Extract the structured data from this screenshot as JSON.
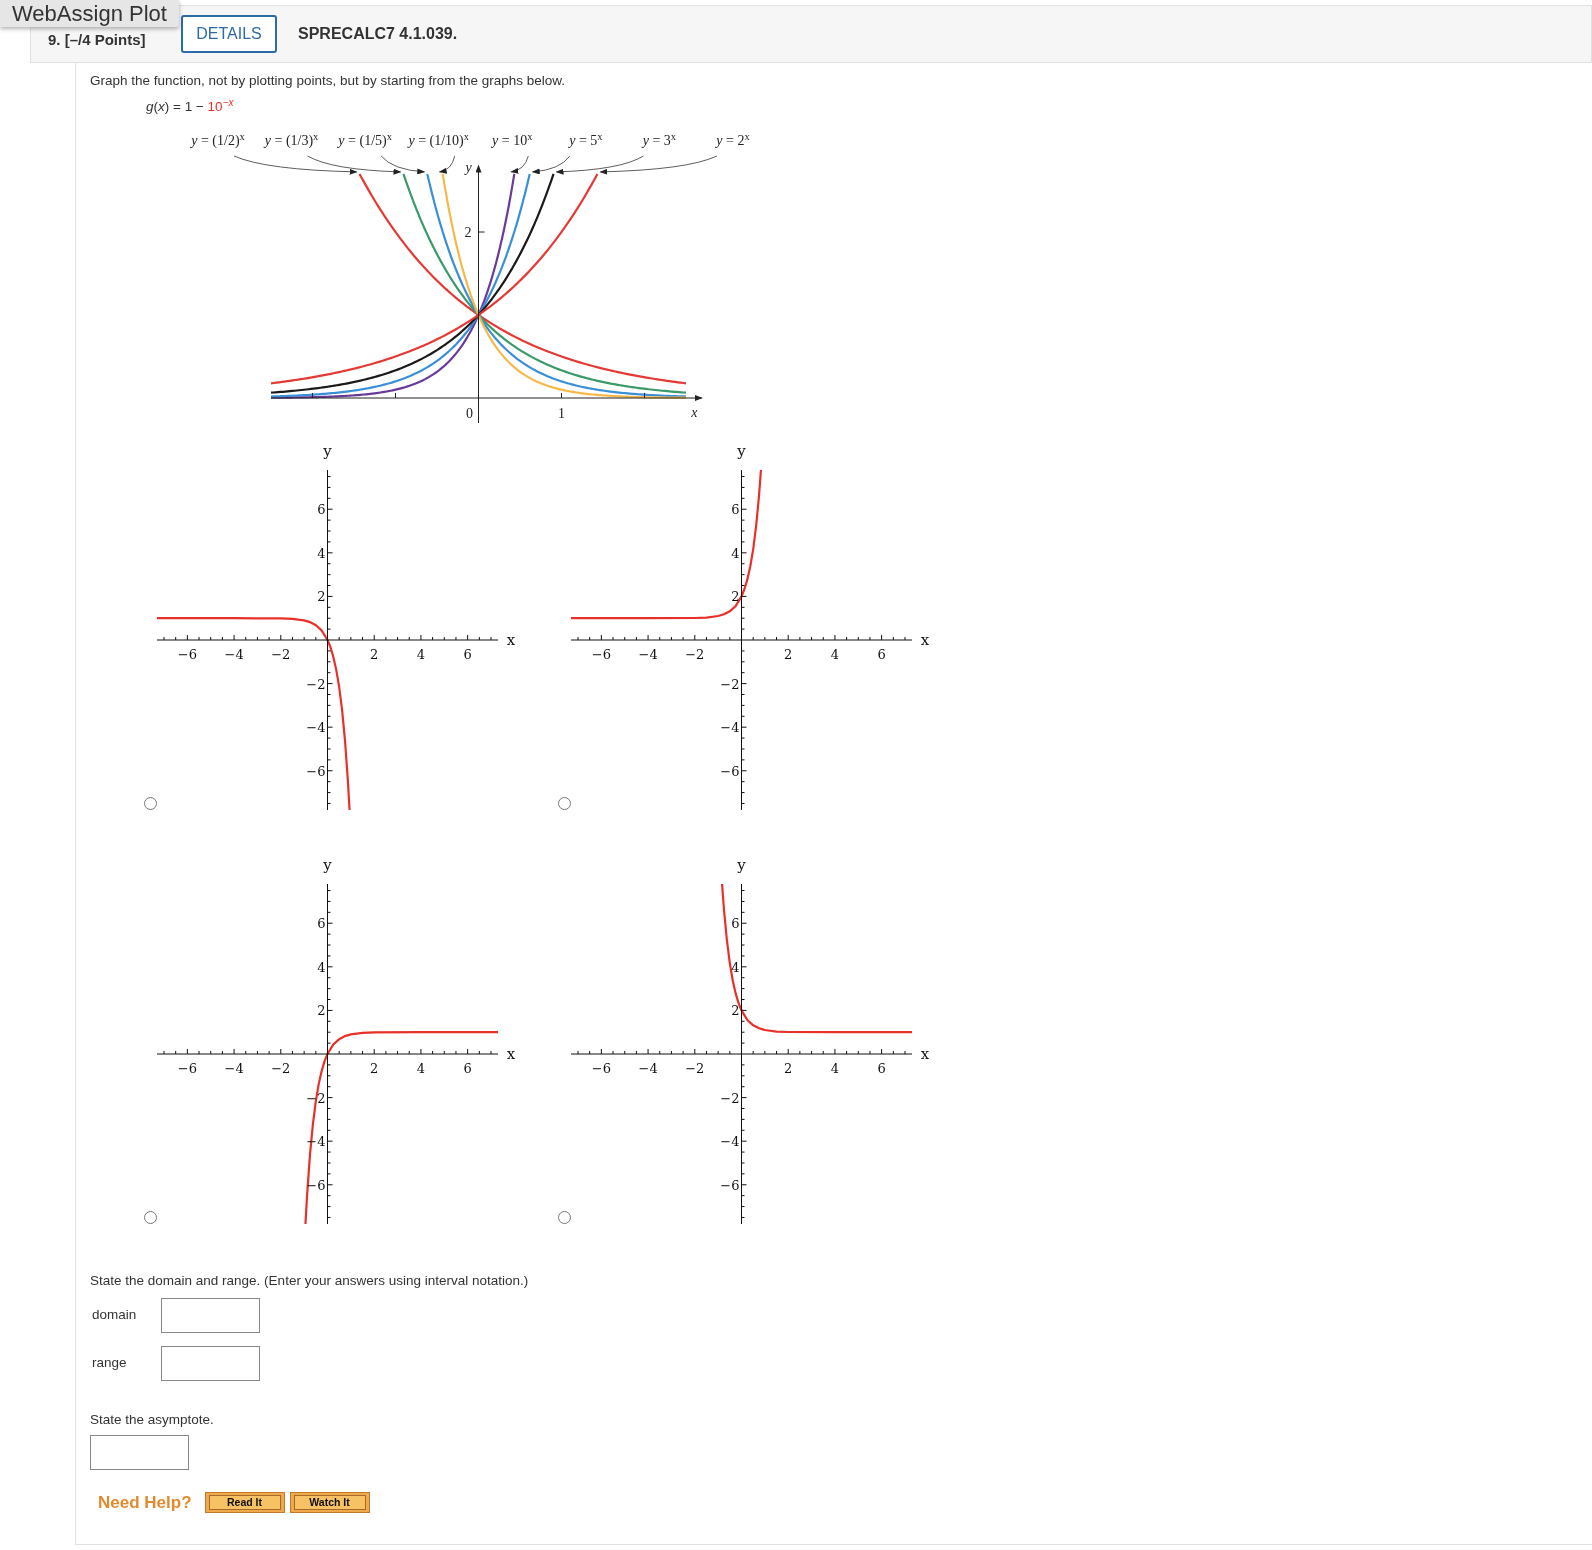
{
  "tooltip": {
    "text": "WebAssign Plot"
  },
  "header": {
    "number": "9. [–/4 Points]",
    "details_button": "DETAILS",
    "problem_id": "SPRECALC7 4.1.039."
  },
  "question": {
    "prompt": "Graph the function, not by plotting points, but by starting from the graphs below.",
    "formula": {
      "text": "*g*(*x*) = 1 − ",
      "highlight": "10$^{−x}$"
    }
  },
  "figure": {
    "x_axis_label": "x",
    "y_axis_label": "y",
    "x_tick_labels": [
      "0",
      "1"
    ],
    "y_tick_labels": [
      "2"
    ],
    "curve_labels": [
      "*y* = (1/2)$^{x}$",
      "*y* = (1/3)$^{x}$",
      "*y* = (1/5)$^{x}$",
      "*y* = (1/10)$^{x}$",
      "*y* = 10$^{x}$",
      "*y* = 5$^{x}$",
      "*y* = 3$^{x}$",
      "*y* = 2$^{x}$"
    ]
  },
  "choices": [
    {
      "selected": false,
      "chart_data": {
        "type": "line",
        "xlabel": "x",
        "ylabel": "y",
        "xlim": [
          -7.3,
          7.3
        ],
        "ylim": [
          -7.8,
          7.8
        ],
        "xticks": [
          {
            "value": -6,
            "label": "−6"
          },
          {
            "value": -4,
            "label": "−4"
          },
          {
            "value": -2,
            "label": "−2"
          },
          2,
          4,
          6
        ],
        "yticks": [
          {
            "value": -6,
            "label": "−6"
          },
          {
            "value": -4,
            "label": "−4"
          },
          {
            "value": -2,
            "label": "−2"
          },
          2,
          4,
          6
        ],
        "x": [
          -7.3,
          -4,
          -2,
          -1.5,
          -1,
          -0.75,
          -0.5,
          -0.25,
          0,
          0.125,
          0.25,
          0.375,
          0.5,
          0.625,
          0.75,
          0.875,
          0.9445
        ],
        "series": [
          {
            "color": "#e8302a",
            "values": [
              1,
              1,
              0.99,
              0.97,
              0.9,
              0.82,
              0.68,
              0.44,
              0,
              -0.33,
              -0.78,
              -1.37,
              -2.16,
              -3.22,
              -4.62,
              -6.5,
              -7.8
            ]
          }
        ]
      }
    },
    {
      "selected": false,
      "chart_data": {
        "type": "line",
        "xlabel": "x",
        "ylabel": "y",
        "xlim": [
          -7.3,
          7.3
        ],
        "ylim": [
          -7.8,
          7.8
        ],
        "xticks": [
          {
            "value": -6,
            "label": "−6"
          },
          {
            "value": -4,
            "label": "−4"
          },
          {
            "value": -2,
            "label": "−2"
          },
          2,
          4,
          6
        ],
        "yticks": [
          {
            "value": -6,
            "label": "−6"
          },
          {
            "value": -4,
            "label": "−4"
          },
          {
            "value": -2,
            "label": "−2"
          },
          2,
          4,
          6
        ],
        "x": [
          -7.3,
          -4,
          -2,
          -1.5,
          -1,
          -0.75,
          -0.5,
          -0.25,
          0,
          0.125,
          0.25,
          0.375,
          0.5,
          0.625,
          0.75,
          0.8325
        ],
        "series": [
          {
            "color": "#e8302a",
            "values": [
              1,
              1,
              1.01,
              1.03,
              1.1,
              1.18,
              1.32,
              1.56,
              2,
              2.33,
              2.78,
              3.37,
              4.16,
              5.22,
              6.62,
              7.8
            ]
          }
        ]
      }
    },
    {
      "selected": false,
      "chart_data": {
        "type": "line",
        "xlabel": "x",
        "ylabel": "y",
        "xlim": [
          -7.3,
          7.3
        ],
        "ylim": [
          -7.8,
          7.8
        ],
        "xticks": [
          {
            "value": -6,
            "label": "−6"
          },
          {
            "value": -4,
            "label": "−4"
          },
          {
            "value": -2,
            "label": "−2"
          },
          2,
          4,
          6
        ],
        "yticks": [
          {
            "value": -6,
            "label": "−6"
          },
          {
            "value": -4,
            "label": "−4"
          },
          {
            "value": -2,
            "label": "−2"
          },
          2,
          4,
          6
        ],
        "x": [
          -0.9445,
          -0.875,
          -0.75,
          -0.625,
          -0.5,
          -0.375,
          -0.25,
          -0.125,
          0,
          0.25,
          0.5,
          0.75,
          1,
          1.5,
          2,
          4,
          7.3
        ],
        "series": [
          {
            "color": "#e8302a",
            "values": [
              -7.8,
              -6.5,
              -4.62,
              -3.22,
              -2.16,
              -1.37,
              -0.78,
              -0.33,
              0,
              0.44,
              0.68,
              0.82,
              0.9,
              0.97,
              0.99,
              1,
              1
            ]
          }
        ]
      }
    },
    {
      "selected": false,
      "chart_data": {
        "type": "line",
        "xlabel": "x",
        "ylabel": "y",
        "xlim": [
          -7.3,
          7.3
        ],
        "ylim": [
          -7.8,
          7.8
        ],
        "xticks": [
          {
            "value": -6,
            "label": "−6"
          },
          {
            "value": -4,
            "label": "−4"
          },
          {
            "value": -2,
            "label": "−2"
          },
          2,
          4,
          6
        ],
        "yticks": [
          {
            "value": -6,
            "label": "−6"
          },
          {
            "value": -4,
            "label": "−4"
          },
          {
            "value": -2,
            "label": "−2"
          },
          2,
          4,
          6
        ],
        "x": [
          -0.8325,
          -0.75,
          -0.625,
          -0.5,
          -0.375,
          -0.25,
          -0.125,
          0,
          0.25,
          0.5,
          0.75,
          1,
          1.5,
          2,
          4,
          7.3
        ],
        "series": [
          {
            "color": "#e8302a",
            "values": [
              7.8,
              6.62,
              5.22,
              4.16,
              3.37,
              2.78,
              2.33,
              2,
              1.56,
              1.32,
              1.18,
              1.1,
              1.03,
              1.01,
              1,
              1
            ]
          }
        ]
      }
    }
  ],
  "domain_range": {
    "prompt": "State the domain and range. (Enter your answers using interval notation.)",
    "fields": [
      {
        "label": "domain"
      },
      {
        "label": "range"
      }
    ]
  },
  "asymptote": {
    "prompt": "State the asymptote."
  },
  "help": {
    "label": "Need Help?",
    "buttons": [
      "Read It",
      "Watch It"
    ]
  }
}
